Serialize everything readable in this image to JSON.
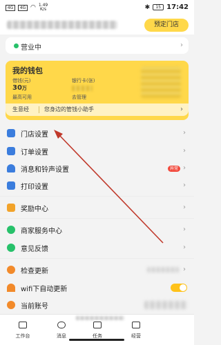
{
  "status_bar": {
    "signal_left": "",
    "speed_value": "1.49",
    "speed_unit": "K/s",
    "battery": "15",
    "time": "17:42"
  },
  "header": {
    "preset_button": "预定门店"
  },
  "business_status": {
    "label": "营业中"
  },
  "wallet": {
    "title": "我的钱包",
    "balance_caption": "借钱(元)",
    "bank_card_caption": "银行卡(张)",
    "balance_value": "30",
    "balance_unit": "万",
    "balance_note": "最高可用",
    "bank_card_note": "去管理",
    "assistant_tag": "生意经",
    "assistant_text": "您身边的管钱小助手"
  },
  "menu": [
    {
      "key": "store-settings",
      "label": "门店设置",
      "icon": "store-icon",
      "color": "#3b7ddd"
    },
    {
      "key": "order-settings",
      "label": "订单设置",
      "icon": "order-icon",
      "color": "#3b7ddd"
    },
    {
      "key": "message-settings",
      "label": "消息和铃声设置",
      "icon": "bell-icon",
      "color": "#3b7ddd",
      "badge": "异常"
    },
    {
      "key": "print-settings",
      "label": "打印设置",
      "icon": "printer-icon",
      "color": "#3b7ddd"
    },
    {
      "key": "rewards-center",
      "label": "奖励中心",
      "icon": "gift-icon",
      "color": "#f2a32a"
    },
    {
      "key": "merchant-service",
      "label": "商家服务中心",
      "icon": "headset-icon",
      "color": "#27c16a"
    },
    {
      "key": "feedback",
      "label": "意见反馈",
      "icon": "feedback-icon",
      "color": "#27c16a"
    },
    {
      "key": "check-update",
      "label": "检查更新",
      "icon": "refresh-icon",
      "color": "#f28a2a"
    },
    {
      "key": "wifi-auto-update",
      "label": "wifi下自动更新",
      "icon": "wifi-icon",
      "color": "#f28a2a"
    },
    {
      "key": "current-account",
      "label": "当前账号",
      "icon": "user-icon",
      "color": "#f28a2a"
    }
  ],
  "bottom_nav": [
    {
      "label": "工作台",
      "icon": "workbench-icon"
    },
    {
      "label": "消息",
      "icon": "message-icon"
    },
    {
      "label": "任务",
      "icon": "task-icon"
    },
    {
      "label": "经营",
      "icon": "business-icon"
    }
  ],
  "colors": {
    "accent": "#ffd84a",
    "annotation_arrow": "#c0392b"
  }
}
